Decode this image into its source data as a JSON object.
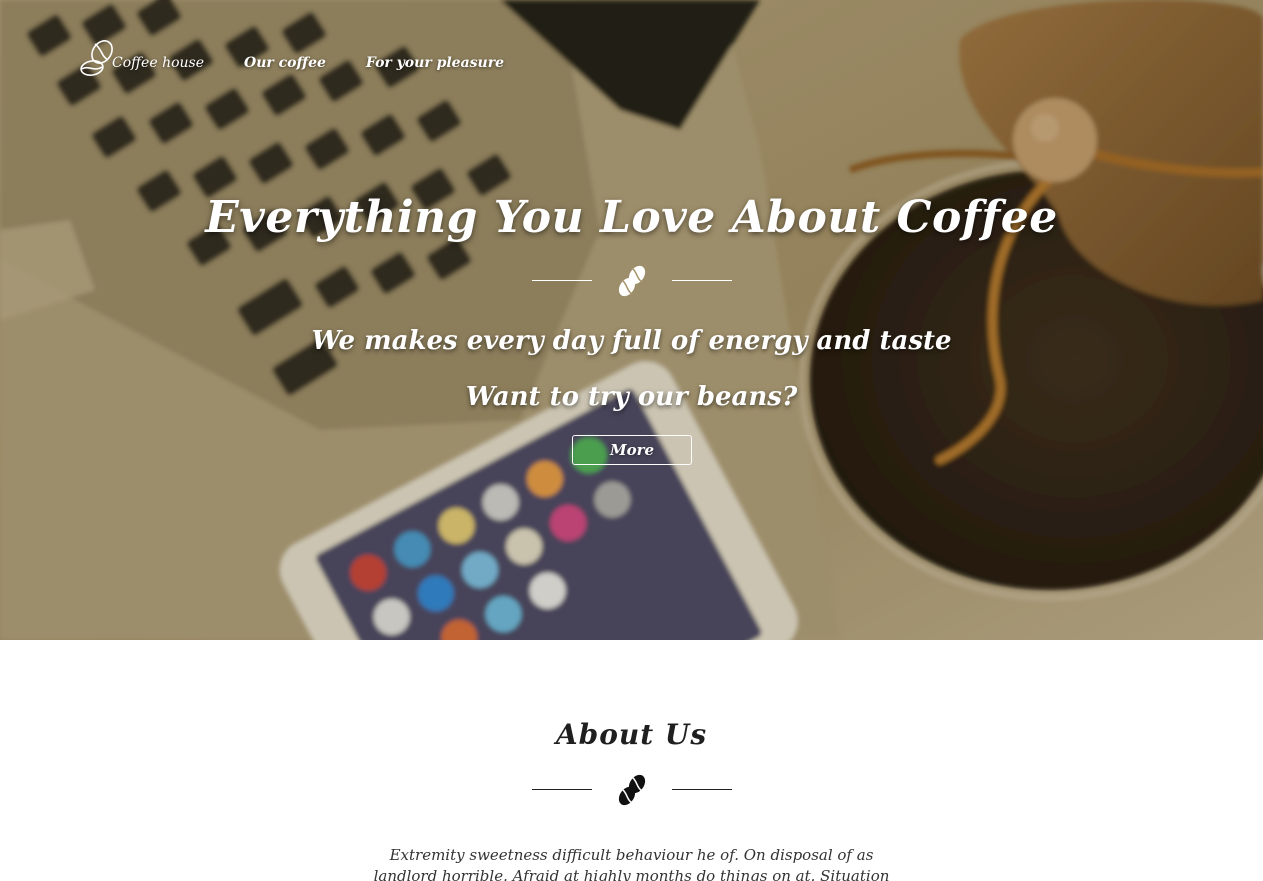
{
  "nav": {
    "logo_label": "Coffee house",
    "links": [
      "Our coffee",
      "For your pleasure"
    ]
  },
  "hero": {
    "title": "Everything You Love About Coffee",
    "subtitle": "We makes every day full of energy and taste",
    "question": "Want to try our beans?",
    "button_label": "More"
  },
  "about": {
    "title": "About Us",
    "text": "Extremity sweetness difficult behaviour he of. On disposal of as landlord horrible. Afraid at highly months do things on at. Situation recommend"
  },
  "icons": {
    "logo": "coffee-beans-outline-icon",
    "hero_divider": "coffee-beans-icon",
    "about_divider": "coffee-beans-icon"
  },
  "colors": {
    "hero_text": "#ffffff",
    "about_text": "#1f1f1f"
  }
}
